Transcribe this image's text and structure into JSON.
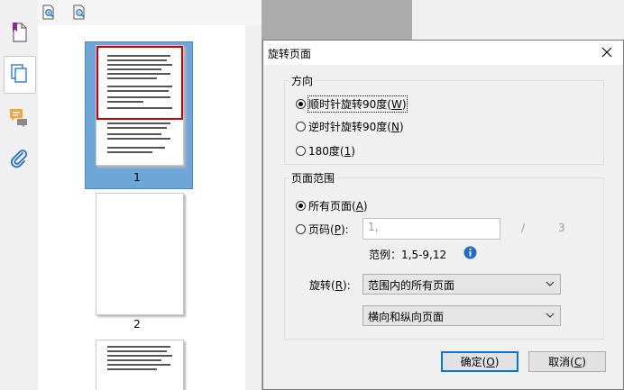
{
  "sidebar": {
    "icons": [
      "bookmark-icon",
      "pages-icon",
      "comments-icon",
      "attachment-icon"
    ]
  },
  "thumbnail_toolbar": {
    "icons": [
      "zoom-in-thumbnail-icon",
      "zoom-out-thumbnail-icon"
    ]
  },
  "thumbnails": {
    "pages": [
      {
        "number": "1",
        "selected": true
      },
      {
        "number": "2",
        "selected": false
      }
    ]
  },
  "dialog": {
    "title": "旋转页面",
    "close_icon": "close-icon",
    "direction": {
      "label": "方向",
      "options": [
        {
          "text": "顺时针旋转90度",
          "hotkey": "W",
          "selected": true
        },
        {
          "text": "逆时针旋转90度",
          "hotkey": "N",
          "selected": false
        },
        {
          "text": "180度",
          "hotkey": "1",
          "selected": false
        }
      ]
    },
    "page_range": {
      "label": "页面范围",
      "all_pages": {
        "text": "所有页面",
        "hotkey": "A",
        "selected": true
      },
      "page_numbers": {
        "text": "页码",
        "hotkey": "P",
        "selected": false,
        "suffix": ":"
      },
      "pages_input_value": "1,",
      "separator": "/",
      "total_pages": "3",
      "example": "范例：1,5-9,12",
      "info_icon": "info-icon",
      "rotate_label": "旋转",
      "rotate_hotkey": "R",
      "rotate_suffix": ":",
      "rotate_select": "范围内的所有页面",
      "orientation_select": "横向和纵向页面"
    },
    "ok": {
      "text": "确定",
      "hotkey": "O"
    },
    "cancel": {
      "text": "取消",
      "hotkey": "C"
    }
  },
  "colors": {
    "selection": "#6fa6d8",
    "page_highlight": "#cc0000",
    "info": "#1f6fc2",
    "default_button_border": "#0078d7"
  }
}
